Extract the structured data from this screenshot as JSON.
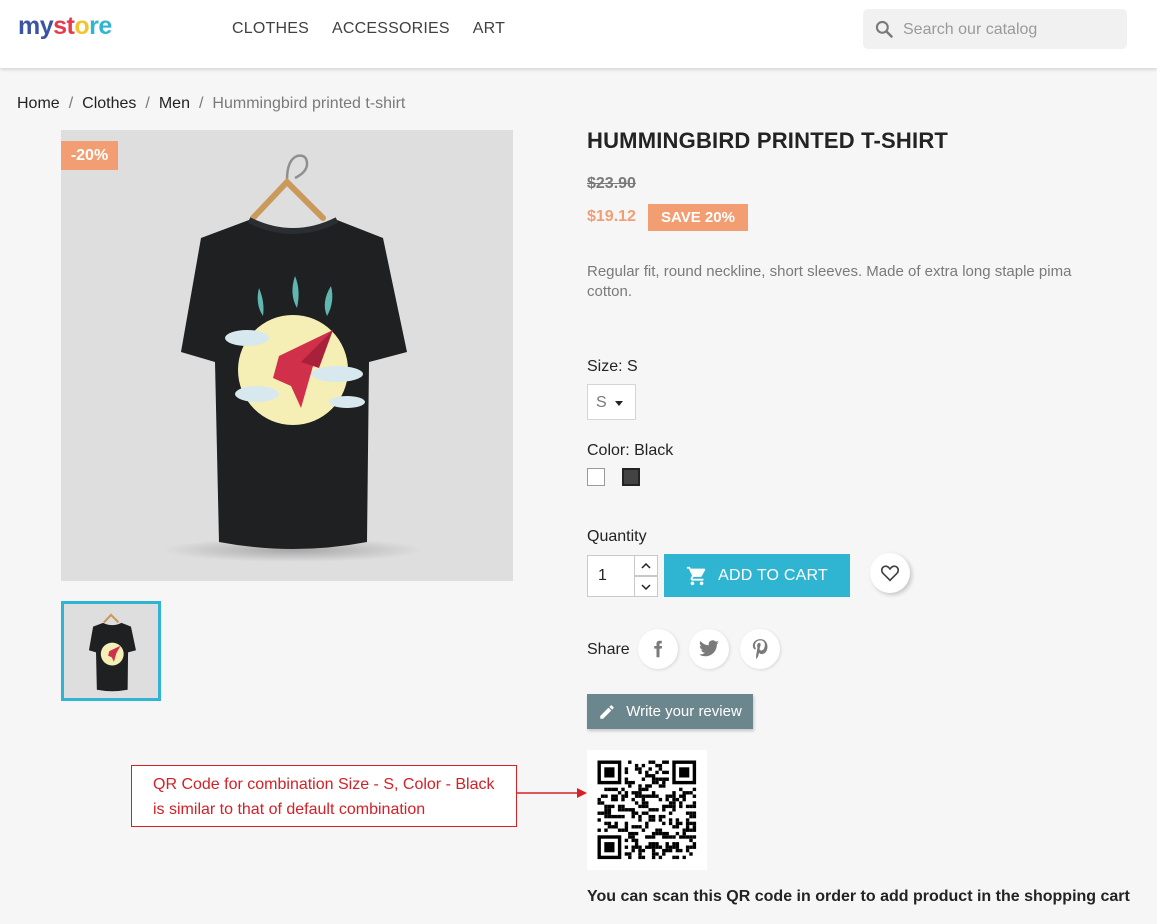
{
  "header": {
    "logo": {
      "part1": "my",
      "part2": "st",
      "part3": "o",
      "part4": "re"
    },
    "nav": [
      "CLOTHES",
      "ACCESSORIES",
      "ART"
    ],
    "search_placeholder": "Search our catalog"
  },
  "breadcrumb": {
    "items": [
      "Home",
      "Clothes",
      "Men"
    ],
    "current": "Hummingbird printed t-shirt",
    "separator": "/"
  },
  "product": {
    "discount_flag": "-20%",
    "title": "HUMMINGBIRD PRINTED T-SHIRT",
    "regular_price": "$23.90",
    "price": "$19.12",
    "save_badge": "SAVE 20%",
    "description": "Regular fit, round neckline, short sleeves. Made of extra long staple pima cotton.",
    "size_label": "Size: S",
    "size_value": "S",
    "color_label": "Color: Black",
    "colors": {
      "white": "#ffffff",
      "black": "#434343"
    },
    "quantity_label": "Quantity",
    "quantity_value": "1",
    "add_to_cart": "ADD TO CART",
    "share_label": "Share",
    "review_button": "Write your review",
    "qr_caption": "You can scan this QR code in order to add product in the shopping cart"
  },
  "annotation": {
    "line1": "QR Code for combination Size - S, Color - Black",
    "line2": "is similar to that of default combination"
  },
  "colors": {
    "accent": "#2fb5d2",
    "discount": "#f39d72",
    "review": "#6c868e",
    "annotation": "#d42027"
  }
}
